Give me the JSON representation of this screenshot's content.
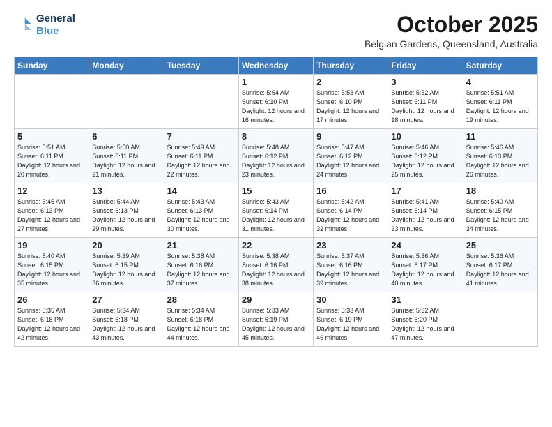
{
  "header": {
    "logo_line1": "General",
    "logo_line2": "Blue",
    "month": "October 2025",
    "location": "Belgian Gardens, Queensland, Australia"
  },
  "weekdays": [
    "Sunday",
    "Monday",
    "Tuesday",
    "Wednesday",
    "Thursday",
    "Friday",
    "Saturday"
  ],
  "weeks": [
    [
      {
        "day": "",
        "info": ""
      },
      {
        "day": "",
        "info": ""
      },
      {
        "day": "",
        "info": ""
      },
      {
        "day": "1",
        "info": "Sunrise: 5:54 AM\nSunset: 6:10 PM\nDaylight: 12 hours\nand 16 minutes."
      },
      {
        "day": "2",
        "info": "Sunrise: 5:53 AM\nSunset: 6:10 PM\nDaylight: 12 hours\nand 17 minutes."
      },
      {
        "day": "3",
        "info": "Sunrise: 5:52 AM\nSunset: 6:11 PM\nDaylight: 12 hours\nand 18 minutes."
      },
      {
        "day": "4",
        "info": "Sunrise: 5:51 AM\nSunset: 6:11 PM\nDaylight: 12 hours\nand 19 minutes."
      }
    ],
    [
      {
        "day": "5",
        "info": "Sunrise: 5:51 AM\nSunset: 6:11 PM\nDaylight: 12 hours\nand 20 minutes."
      },
      {
        "day": "6",
        "info": "Sunrise: 5:50 AM\nSunset: 6:11 PM\nDaylight: 12 hours\nand 21 minutes."
      },
      {
        "day": "7",
        "info": "Sunrise: 5:49 AM\nSunset: 6:11 PM\nDaylight: 12 hours\nand 22 minutes."
      },
      {
        "day": "8",
        "info": "Sunrise: 5:48 AM\nSunset: 6:12 PM\nDaylight: 12 hours\nand 23 minutes."
      },
      {
        "day": "9",
        "info": "Sunrise: 5:47 AM\nSunset: 6:12 PM\nDaylight: 12 hours\nand 24 minutes."
      },
      {
        "day": "10",
        "info": "Sunrise: 5:46 AM\nSunset: 6:12 PM\nDaylight: 12 hours\nand 25 minutes."
      },
      {
        "day": "11",
        "info": "Sunrise: 5:46 AM\nSunset: 6:13 PM\nDaylight: 12 hours\nand 26 minutes."
      }
    ],
    [
      {
        "day": "12",
        "info": "Sunrise: 5:45 AM\nSunset: 6:13 PM\nDaylight: 12 hours\nand 27 minutes."
      },
      {
        "day": "13",
        "info": "Sunrise: 5:44 AM\nSunset: 6:13 PM\nDaylight: 12 hours\nand 29 minutes."
      },
      {
        "day": "14",
        "info": "Sunrise: 5:43 AM\nSunset: 6:13 PM\nDaylight: 12 hours\nand 30 minutes."
      },
      {
        "day": "15",
        "info": "Sunrise: 5:43 AM\nSunset: 6:14 PM\nDaylight: 12 hours\nand 31 minutes."
      },
      {
        "day": "16",
        "info": "Sunrise: 5:42 AM\nSunset: 6:14 PM\nDaylight: 12 hours\nand 32 minutes."
      },
      {
        "day": "17",
        "info": "Sunrise: 5:41 AM\nSunset: 6:14 PM\nDaylight: 12 hours\nand 33 minutes."
      },
      {
        "day": "18",
        "info": "Sunrise: 5:40 AM\nSunset: 6:15 PM\nDaylight: 12 hours\nand 34 minutes."
      }
    ],
    [
      {
        "day": "19",
        "info": "Sunrise: 5:40 AM\nSunset: 6:15 PM\nDaylight: 12 hours\nand 35 minutes."
      },
      {
        "day": "20",
        "info": "Sunrise: 5:39 AM\nSunset: 6:15 PM\nDaylight: 12 hours\nand 36 minutes."
      },
      {
        "day": "21",
        "info": "Sunrise: 5:38 AM\nSunset: 6:16 PM\nDaylight: 12 hours\nand 37 minutes."
      },
      {
        "day": "22",
        "info": "Sunrise: 5:38 AM\nSunset: 6:16 PM\nDaylight: 12 hours\nand 38 minutes."
      },
      {
        "day": "23",
        "info": "Sunrise: 5:37 AM\nSunset: 6:16 PM\nDaylight: 12 hours\nand 39 minutes."
      },
      {
        "day": "24",
        "info": "Sunrise: 5:36 AM\nSunset: 6:17 PM\nDaylight: 12 hours\nand 40 minutes."
      },
      {
        "day": "25",
        "info": "Sunrise: 5:36 AM\nSunset: 6:17 PM\nDaylight: 12 hours\nand 41 minutes."
      }
    ],
    [
      {
        "day": "26",
        "info": "Sunrise: 5:35 AM\nSunset: 6:18 PM\nDaylight: 12 hours\nand 42 minutes."
      },
      {
        "day": "27",
        "info": "Sunrise: 5:34 AM\nSunset: 6:18 PM\nDaylight: 12 hours\nand 43 minutes."
      },
      {
        "day": "28",
        "info": "Sunrise: 5:34 AM\nSunset: 6:18 PM\nDaylight: 12 hours\nand 44 minutes."
      },
      {
        "day": "29",
        "info": "Sunrise: 5:33 AM\nSunset: 6:19 PM\nDaylight: 12 hours\nand 45 minutes."
      },
      {
        "day": "30",
        "info": "Sunrise: 5:33 AM\nSunset: 6:19 PM\nDaylight: 12 hours\nand 46 minutes."
      },
      {
        "day": "31",
        "info": "Sunrise: 5:32 AM\nSunset: 6:20 PM\nDaylight: 12 hours\nand 47 minutes."
      },
      {
        "day": "",
        "info": ""
      }
    ]
  ]
}
